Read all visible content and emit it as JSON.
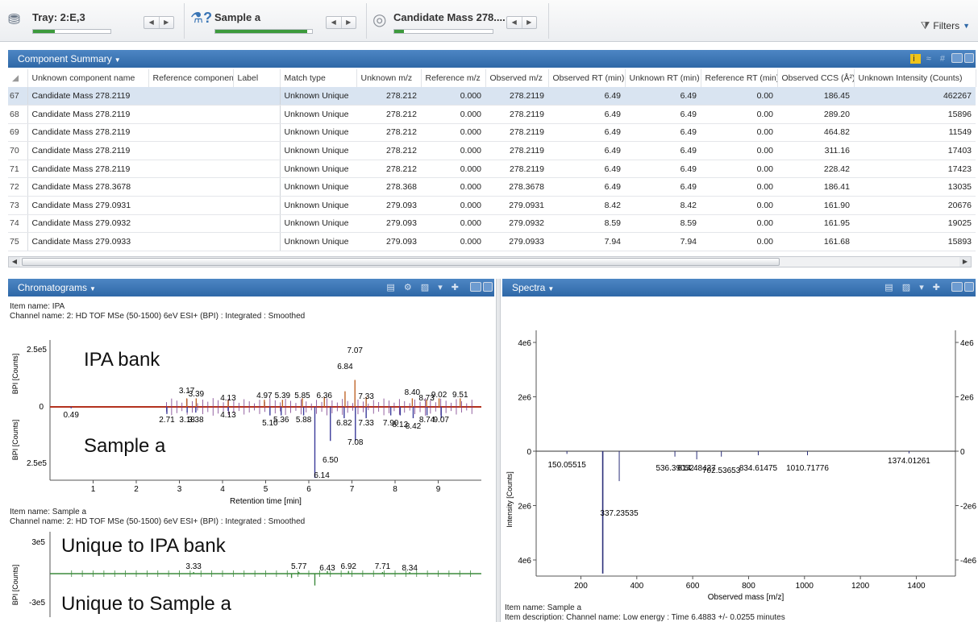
{
  "toolbar": {
    "tray_title": "Tray: 2:E,3",
    "sample_title": "Sample a",
    "candidate_title": "Candidate Mass 278....",
    "tray_progress": 0.28,
    "sample_progress": 0.95,
    "candidate_progress": 0.1,
    "prev_glyph": "◀",
    "next_glyph": "▶",
    "filters_label": "Filters"
  },
  "component_summary": {
    "header": "Component Summary",
    "columns": [
      "Unknown component name",
      "Reference component...",
      "Label",
      "Match type",
      "Unknown m/z",
      "Reference m/z",
      "Observed m/z",
      "Observed RT (min)",
      "Unknown RT (min)",
      "Reference RT (min)",
      "Observed CCS (Å²)",
      "Unknown Intensity (Counts)"
    ],
    "rows": [
      {
        "n": "67",
        "name": "Candidate Mass 278.2119",
        "ref": "",
        "label": "",
        "match": "Unknown Unique",
        "umz": "278.212",
        "rmz": "0.000",
        "omz": "278.2119",
        "ort": "6.49",
        "urt": "6.49",
        "rrt": "0.00",
        "ccs": "186.45",
        "int": "462267"
      },
      {
        "n": "68",
        "name": "Candidate Mass 278.2119",
        "ref": "",
        "label": "",
        "match": "Unknown Unique",
        "umz": "278.212",
        "rmz": "0.000",
        "omz": "278.2119",
        "ort": "6.49",
        "urt": "6.49",
        "rrt": "0.00",
        "ccs": "289.20",
        "int": "15896"
      },
      {
        "n": "69",
        "name": "Candidate Mass 278.2119",
        "ref": "",
        "label": "",
        "match": "Unknown Unique",
        "umz": "278.212",
        "rmz": "0.000",
        "omz": "278.2119",
        "ort": "6.49",
        "urt": "6.49",
        "rrt": "0.00",
        "ccs": "464.82",
        "int": "11549"
      },
      {
        "n": "70",
        "name": "Candidate Mass 278.2119",
        "ref": "",
        "label": "",
        "match": "Unknown Unique",
        "umz": "278.212",
        "rmz": "0.000",
        "omz": "278.2119",
        "ort": "6.49",
        "urt": "6.49",
        "rrt": "0.00",
        "ccs": "311.16",
        "int": "17403"
      },
      {
        "n": "71",
        "name": "Candidate Mass 278.2119",
        "ref": "",
        "label": "",
        "match": "Unknown Unique",
        "umz": "278.212",
        "rmz": "0.000",
        "omz": "278.2119",
        "ort": "6.49",
        "urt": "6.49",
        "rrt": "0.00",
        "ccs": "228.42",
        "int": "17423"
      },
      {
        "n": "72",
        "name": "Candidate Mass 278.3678",
        "ref": "",
        "label": "",
        "match": "Unknown Unique",
        "umz": "278.368",
        "rmz": "0.000",
        "omz": "278.3678",
        "ort": "6.49",
        "urt": "6.49",
        "rrt": "0.00",
        "ccs": "186.41",
        "int": "13035"
      },
      {
        "n": "73",
        "name": "Candidate Mass 279.0931",
        "ref": "",
        "label": "",
        "match": "Unknown Unique",
        "umz": "279.093",
        "rmz": "0.000",
        "omz": "279.0931",
        "ort": "8.42",
        "urt": "8.42",
        "rrt": "0.00",
        "ccs": "161.90",
        "int": "20676"
      },
      {
        "n": "74",
        "name": "Candidate Mass 279.0932",
        "ref": "",
        "label": "",
        "match": "Unknown Unique",
        "umz": "279.093",
        "rmz": "0.000",
        "omz": "279.0932",
        "ort": "8.59",
        "urt": "8.59",
        "rrt": "0.00",
        "ccs": "161.95",
        "int": "19025"
      },
      {
        "n": "75",
        "name": "Candidate Mass 279.0933",
        "ref": "",
        "label": "",
        "match": "Unknown Unique",
        "umz": "279.093",
        "rmz": "0.000",
        "omz": "279.0933",
        "ort": "7.94",
        "urt": "7.94",
        "rrt": "0.00",
        "ccs": "161.68",
        "int": "15893"
      }
    ]
  },
  "chromatograms": {
    "header": "Chromatograms",
    "item1": "Item name: IPA",
    "channel1": "Channel name: 2: HD TOF MSe (50-1500) 6eV ESI+ (BPI) : Integrated : Smoothed",
    "item2": "Item name: Sample a",
    "channel2": "Channel name: 2: HD TOF MSe (50-1500) 6eV ESI+ (BPI) : Integrated : Smoothed",
    "top_label": "IPA bank",
    "bottom_label": "Sample a",
    "unique_top_label": "Unique to IPA bank",
    "unique_bottom_label": "Unique to Sample a",
    "ylabel": "BPI [Counts]",
    "xlabel": "Retention time [min]",
    "tick_top": "2.5e5",
    "tick_zero": "0",
    "tick_bottom": "2.5e5",
    "tick2_top": "3e5",
    "tick2_bottom": "-3e5"
  },
  "spectra": {
    "header": "Spectra",
    "xlabel": "Observed mass [m/z]",
    "ylabel": "Intensity [Counts]",
    "item": "Item name: Sample a",
    "description": "Item description:   Channel name: Low energy : Time 6.4883 +/- 0.0255 minutes"
  },
  "chart_data": [
    {
      "type": "line",
      "title": "",
      "xlabel": "Retention time [min]",
      "ylabel": "BPI [Counts]",
      "xlim": [
        0,
        10
      ],
      "ylim": [
        -250000,
        250000
      ],
      "xticks": [
        1,
        2,
        3,
        4,
        5,
        6,
        7,
        8,
        9
      ],
      "upper_labels": [
        "7.07",
        "6.84",
        "8.40",
        "8.73",
        "9.02",
        "9.51",
        "3.17",
        "3.39",
        "4.13",
        "4.97",
        "5.39",
        "5.85",
        "6.36",
        "7.33"
      ],
      "lower_labels": [
        "0.49",
        "2.71",
        "3.18",
        "3.38",
        "4.13",
        "5.10",
        "5.36",
        "5.88",
        "6.82",
        "7.33",
        "7.90",
        "8.12",
        "8.42",
        "8.74",
        "9.07",
        "7.08",
        "6.50",
        "6.14"
      ],
      "series": [
        {
          "x": [
            3.17,
            3.39,
            4.13,
            4.97,
            5.39,
            5.85,
            6.36,
            6.84,
            7.07,
            7.33,
            8.4,
            8.73,
            9.02,
            9.51
          ],
          "y": [
            30000,
            30000,
            25000,
            25000,
            25000,
            30000,
            35000,
            55000,
            95000,
            35000,
            30000,
            25000,
            30000,
            30000
          ]
        },
        {
          "x": [
            0.49,
            2.71,
            3.18,
            3.38,
            4.13,
            5.1,
            5.36,
            5.88,
            6.14,
            6.5,
            6.82,
            7.08,
            7.33,
            7.9,
            8.12,
            8.42,
            8.74,
            9.07
          ],
          "y": [
            -5000,
            -25000,
            -20000,
            -20000,
            -15000,
            -30000,
            -30000,
            -30000,
            -250000,
            -120000,
            -40000,
            -120000,
            -40000,
            -30000,
            -30000,
            -40000,
            -30000,
            -40000
          ]
        }
      ]
    },
    {
      "type": "line",
      "title": "",
      "ylabel": "BPI [Counts]",
      "ylim": [
        -300000,
        300000
      ],
      "xlim": [
        0,
        10
      ],
      "upper_labels": [
        "3.33",
        "5.77",
        "6.43",
        "6.92",
        "7.71",
        "8.34"
      ],
      "series": [
        {
          "x": [
            3.33,
            5.77,
            6.43,
            6.92,
            7.71,
            8.34
          ],
          "y": [
            15000,
            15000,
            25000,
            25000,
            15000,
            15000
          ]
        },
        {
          "x": [
            5.6,
            6.14
          ],
          "y": [
            -40000,
            -110000
          ]
        }
      ]
    },
    {
      "type": "bar",
      "title": "",
      "xlabel": "Observed mass [m/z]",
      "ylabel": "Intensity [Counts]",
      "xlim": [
        40,
        1540
      ],
      "ylim": [
        -4500000,
        4500000
      ],
      "xticks": [
        200,
        400,
        600,
        800,
        1000,
        1200,
        1400
      ],
      "yticks_left": [
        "4e6",
        "2e6",
        "0",
        "2e6",
        "4e6"
      ],
      "yticks_right": [
        "4e6",
        "2e6",
        "0",
        "-2e6",
        "-4e6"
      ],
      "peaks": [
        {
          "mz": 150.05515,
          "y": -100000,
          "label": "150.05515"
        },
        {
          "mz": 278.2119,
          "y": -4500000,
          "label": ""
        },
        {
          "mz": 337.23535,
          "y": -1100000,
          "label": "337.23535"
        },
        {
          "mz": 536.39052,
          "y": -200000,
          "label": "536.39052"
        },
        {
          "mz": 614.48427,
          "y": -300000,
          "label": "614.48427"
        },
        {
          "mz": 702.53653,
          "y": -200000,
          "label": "702.53653"
        },
        {
          "mz": 834.61475,
          "y": -150000,
          "label": "834.61475"
        },
        {
          "mz": 1010.71776,
          "y": -150000,
          "label": "1010.71776"
        },
        {
          "mz": 1374.01261,
          "y": -80000,
          "label": "1374.01261"
        }
      ]
    }
  ]
}
